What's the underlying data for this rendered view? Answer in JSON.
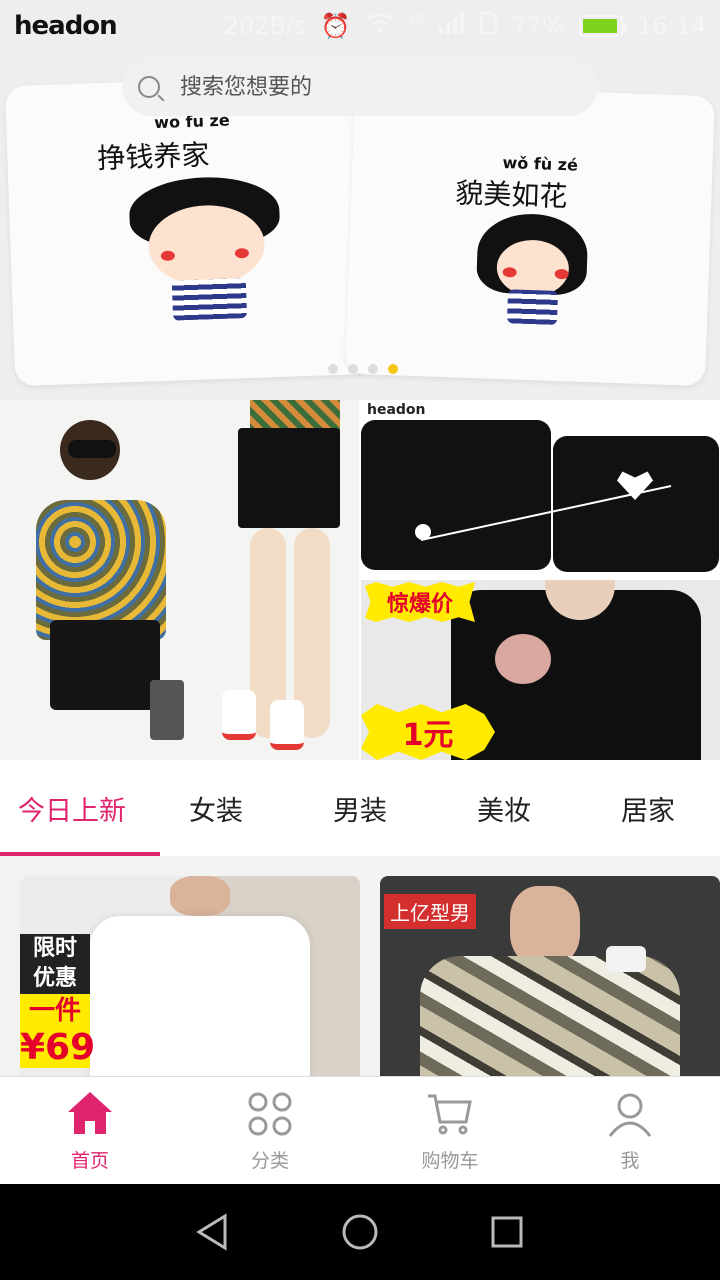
{
  "status_bar": {
    "brand": "headon",
    "net_speed": "202B/s",
    "network": "4G",
    "battery": "77%",
    "time": "16:14"
  },
  "search": {
    "placeholder": "搜索您想要的"
  },
  "banner": {
    "left_shirt_pinyin": "wo fu ze",
    "left_shirt_text": "挣钱养家",
    "right_shirt_pinyin": "wǒ fù zé",
    "right_shirt_text": "貌美如花",
    "page_count": 4,
    "active_page": 4
  },
  "promo": {
    "brand_tag": "headon",
    "burst_label": "惊爆价",
    "price_label": "1元"
  },
  "tabs": [
    {
      "label": "今日上新",
      "active": true
    },
    {
      "label": "女装",
      "active": false
    },
    {
      "label": "男装",
      "active": false
    },
    {
      "label": "美妆",
      "active": false
    },
    {
      "label": "居家",
      "active": false
    }
  ],
  "products": [
    {
      "tag_line1": "限时",
      "tag_line2": "优惠",
      "tag_line3": "一件",
      "tag_price": "¥69"
    },
    {
      "badge": "上亿型男"
    }
  ],
  "bottom_nav": [
    {
      "label": "首页",
      "icon": "home-icon",
      "active": true
    },
    {
      "label": "分类",
      "icon": "category-icon",
      "active": false
    },
    {
      "label": "购物车",
      "icon": "cart-icon",
      "active": false
    },
    {
      "label": "我",
      "icon": "user-icon",
      "active": false
    }
  ],
  "colors": {
    "accent": "#e0256f",
    "inactive": "#999999",
    "promo_yellow": "#ffea00",
    "promo_red": "#e4002b"
  }
}
